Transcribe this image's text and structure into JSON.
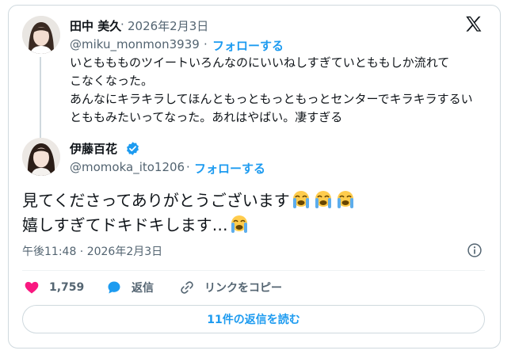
{
  "quoted": {
    "name": "田中 美久",
    "dot": "·",
    "date": "2026年2月3日",
    "handle": "@miku_monmon3939",
    "follow_label": "フォローする",
    "lines": [
      "いとももものツイートいろんなのにいいねしすぎていとももしか流れて",
      "こなくなった。",
      "あんなにキラキラしてほんともっともっともっとセンターでキラキラするい",
      "とももみたいってなった。あれはやばい。凄すぎる"
    ]
  },
  "tweet": {
    "name": "伊藤百花",
    "handle": "@momoka_ito1206",
    "dot": "·",
    "follow_label": "フォローする",
    "line1": "見てくださってありがとうございます",
    "line2": "嬉しすぎてドキドキします…",
    "emoji": "loudly-crying-face",
    "timestamp": "午後11:48 · 2026年2月3日"
  },
  "actions": {
    "like_count": "1,759",
    "reply_label": "返信",
    "copy_link_label": "リンクをコピー"
  },
  "replies_button_label": "11件の返信を読む",
  "colors": {
    "accent": "#1d9bf0",
    "like": "#f91880",
    "secondary_text": "#536471"
  }
}
